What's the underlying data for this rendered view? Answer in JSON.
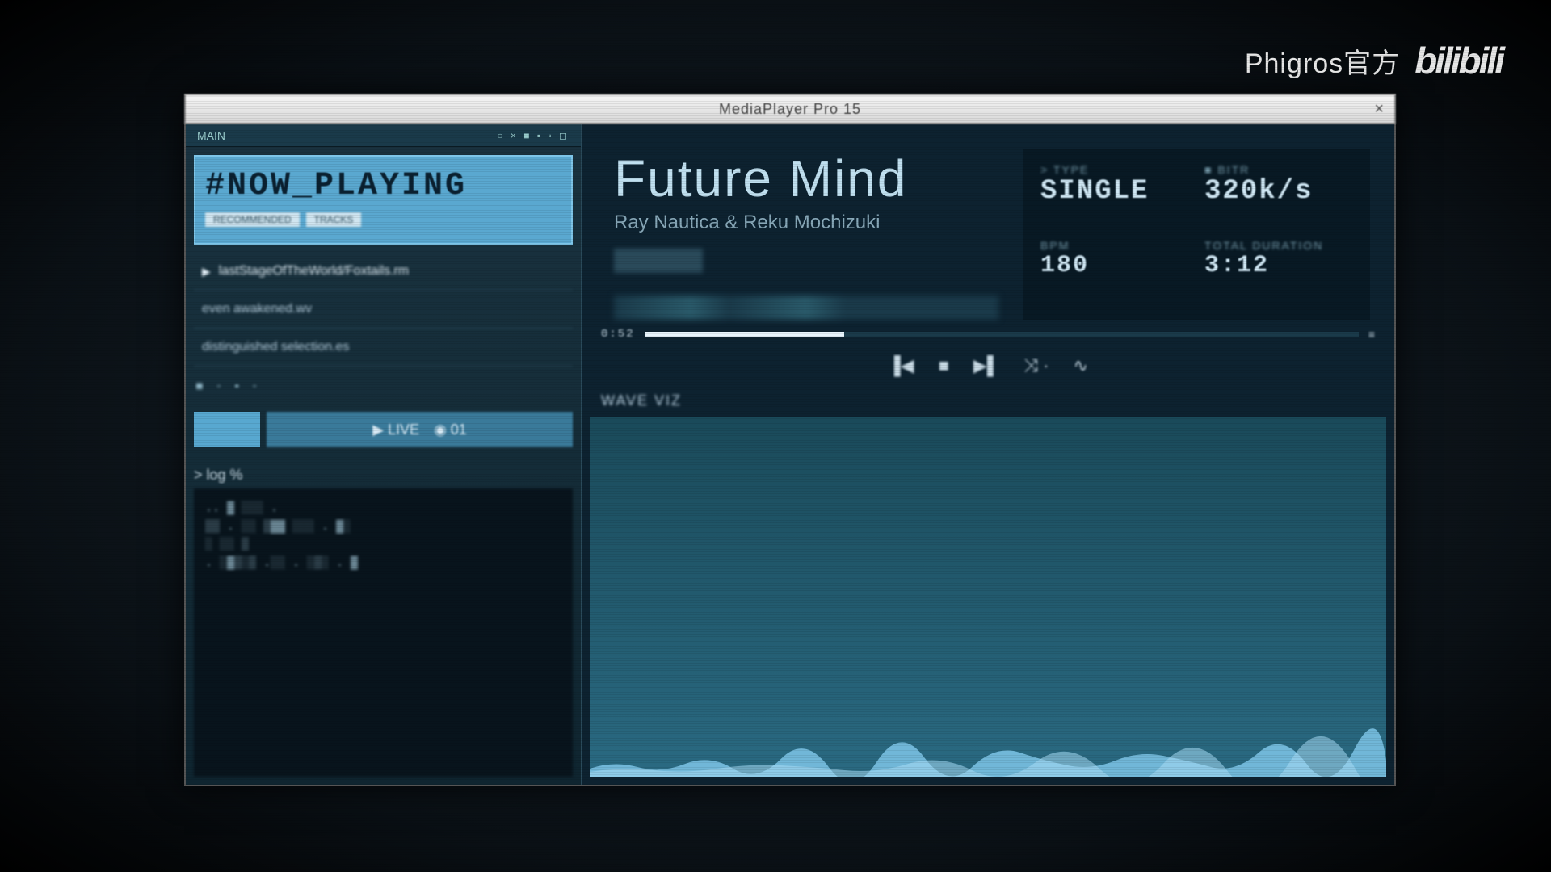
{
  "watermark": {
    "text": "Phigros官方",
    "logo": "bilibili"
  },
  "window": {
    "title": "MediaPlayer Pro 15",
    "close": "×"
  },
  "sidebar": {
    "tab": "MAIN",
    "tab_dots": "○ × ■ ▪ ▫ ◻",
    "now_playing": "#NOW_PLAYING",
    "pills": [
      "RECOMMENDED",
      "TRACKS"
    ],
    "tracks": [
      "lastStageOfTheWorld/Foxtails.rm",
      "even awakened.wv",
      "distinguished selection.es"
    ],
    "dots": "■   ◦   ▪   ◦",
    "buttons": {
      "small": "",
      "large_left": "▶ LIVE",
      "large_right": "◉ 01"
    },
    "terminal_header": "> log %",
    "terminal_body": "   ..  ▓ ░░░    .\n▒▒ . ░░ ▒▓▓  ░░░ . ▓░\n░  ░░  ▒\n. ░▓▒░▒  .░░ . ░▒░  . ▓"
  },
  "song": {
    "title": "Future Mind",
    "artist": "Ray Nautica & Reku Mochizuki"
  },
  "metrics": {
    "m1_label": "> TYPE",
    "m1_val": "SINGLE",
    "m2_label": "■ BITR",
    "m2_val": "320k/s",
    "m3_label": "BPM",
    "m3_val": "180",
    "m4_label": "TOTAL DURATION",
    "m4_val": "3:12"
  },
  "progress": {
    "left": "0:52",
    "right_icon": "≡",
    "fill_pct": 28
  },
  "transport": {
    "prev": "▐◀",
    "stop": "■",
    "next": "▶▌",
    "shuffle": "⤨ ·",
    "repeat": "∿"
  },
  "visualizer": {
    "label": "WAVE  VIZ"
  }
}
